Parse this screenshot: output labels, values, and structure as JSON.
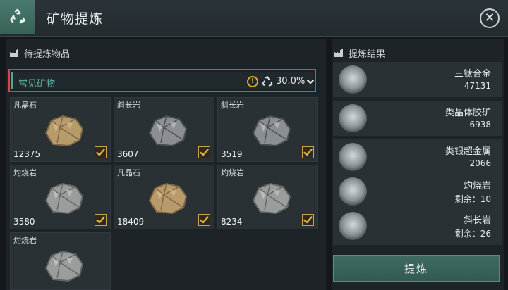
{
  "window": {
    "title": "矿物提炼"
  },
  "left": {
    "section_title": "待提炼物品",
    "filter": {
      "label": "常见矿物",
      "percent": "30.0%"
    },
    "items": [
      {
        "name": "凡晶石",
        "count": "12375",
        "checked": true,
        "rock": "gold"
      },
      {
        "name": "斜长岩",
        "count": "3607",
        "checked": true,
        "rock": "dark"
      },
      {
        "name": "斜长岩",
        "count": "3519",
        "checked": true,
        "rock": "dark"
      },
      {
        "name": "灼烧岩",
        "count": "3580",
        "checked": true,
        "rock": "grey"
      },
      {
        "name": "凡晶石",
        "count": "18409",
        "checked": true,
        "rock": "gold"
      },
      {
        "name": "灼烧岩",
        "count": "8234",
        "checked": true,
        "rock": "grey"
      },
      {
        "name": "灼烧岩",
        "count": "",
        "checked": false,
        "rock": "grey"
      }
    ]
  },
  "right": {
    "section_title": "提炼结果",
    "results": [
      {
        "name": "三钛合金",
        "value": "47131",
        "icon": "titanium-alloy-icon"
      },
      {
        "name": "类晶体胶矿",
        "value": "6938",
        "icon": "crystal-ore-icon"
      },
      {
        "name": "类银超金属",
        "value": "2066",
        "icon": "silver-metal-icon"
      },
      {
        "name": "灼烧岩",
        "value": "剩余：10",
        "icon": "burnt-rock-icon"
      },
      {
        "name": "斜长岩",
        "value": "剩余：26",
        "icon": "plagioclase-icon"
      }
    ],
    "refine_button": "提炼"
  },
  "colors": {
    "accent": "#5aa293",
    "highlight_border": "#d9434a",
    "check": "#e0b040",
    "warning": "#e0a92d"
  }
}
